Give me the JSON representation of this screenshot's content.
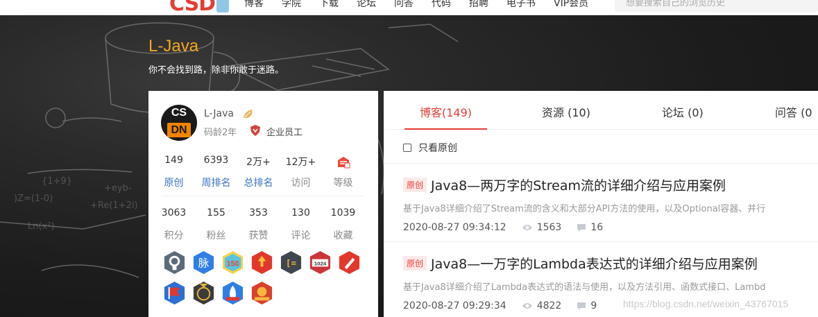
{
  "topnav": {
    "logo": "CSD",
    "items": [
      "博客",
      "学院",
      "下载",
      "论坛",
      "问答",
      "代码",
      "招聘",
      "电子书",
      "VIP会员"
    ],
    "search_placeholder": "想要搜索自己的浏览历史"
  },
  "header": {
    "title": "L-Java",
    "motto": "你不会找到路，除非你敢于迷路。"
  },
  "profile": {
    "avatar_top": "CS",
    "avatar_bottom": "DN",
    "name": "L-Java",
    "age": "码龄2年",
    "role": "企业员工",
    "stats_row1": [
      {
        "num": "149",
        "label": "原创"
      },
      {
        "num": "6393",
        "label": "周排名"
      },
      {
        "num": "2万+",
        "label": "总排名"
      },
      {
        "num": "12万+",
        "label": "访问"
      },
      {
        "num": "",
        "label": "等级"
      }
    ],
    "stats_row2": [
      {
        "num": "3063",
        "label": "积分"
      },
      {
        "num": "155",
        "label": "粉丝"
      },
      {
        "num": "353",
        "label": "获赞"
      },
      {
        "num": "130",
        "label": "评论"
      },
      {
        "num": "1039",
        "label": "收藏"
      }
    ],
    "badges_row1": [
      "github-badge",
      "mai-badge",
      "150-badge",
      "2020-badge",
      "bracket-badge",
      "1024-badge",
      "pen-badge"
    ],
    "badges_row2": [
      "flag-badge",
      "medal-badge",
      "rocket-badge",
      "blog-expert-badge"
    ],
    "badge_text": {
      "mai": "脉",
      "n150": "150",
      "n1024": "1024",
      "bracket": "[="
    }
  },
  "content": {
    "tabs": [
      "博客(149)",
      "资源 (10)",
      "论坛 (0)",
      "问答 (0"
    ],
    "filter_label": "只看原创",
    "articles": [
      {
        "tag": "原创",
        "title": "Java8—两万字的Stream流的详细介绍与应用案例",
        "desc": "基于Java8详细介绍了Stream流的含义和大部分API方法的使用，以及Optional容器、并行",
        "date": "2020-08-27 09:34:12",
        "views": "1563",
        "comments": "16"
      },
      {
        "tag": "原创",
        "title": "Java8—一万字的Lambda表达式的详细介绍与应用案例",
        "desc": "基于Java8详细介绍了Lambda表达式的语法与使用，以及方法引用、函数式接口、Lambd",
        "date": "2020-08-27 09:29:34",
        "views": "4822",
        "comments": "9"
      }
    ]
  },
  "watermark": "https://blog.csdn.net/weixin_43767015",
  "colors": {
    "accent": "#e33e33",
    "title_orange": "#f5a623",
    "link_blue": "#3a72c4"
  }
}
